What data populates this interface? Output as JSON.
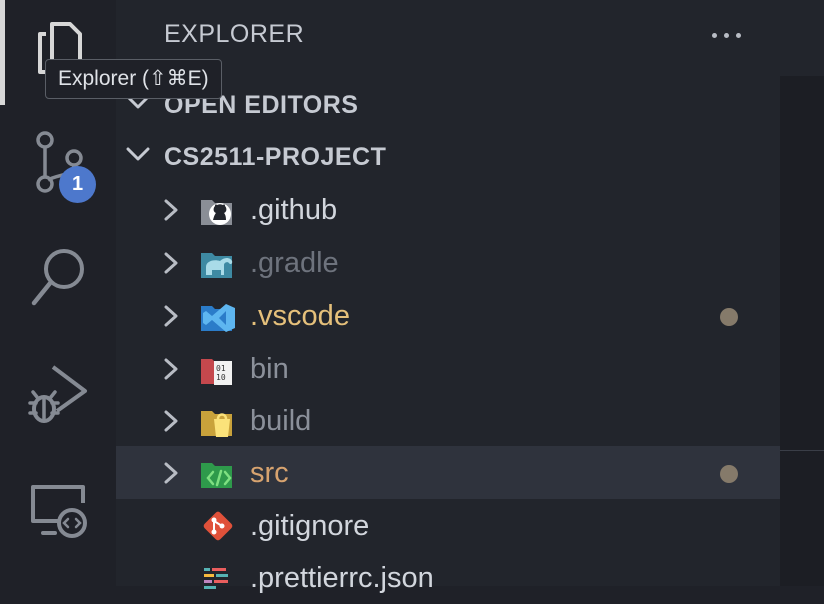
{
  "activity_bar": {
    "items": [
      "files-icon",
      "source-control-icon",
      "search-icon",
      "run-debug-icon",
      "remote-explorer-icon"
    ],
    "source_control_badge": "1"
  },
  "sidebar": {
    "title": "EXPLORER",
    "sections": {
      "open_editors": "OPEN EDITORS",
      "project": "CS2511-PROJECT"
    },
    "tree": [
      {
        "name": ".github",
        "icon": "github-folder-icon",
        "color": "#d2d6dd",
        "folder": true,
        "modified": false
      },
      {
        "name": ".gradle",
        "icon": "gradle-folder-icon",
        "color": "#6e737d",
        "folder": true,
        "modified": false
      },
      {
        "name": ".vscode",
        "icon": "vscode-folder-icon",
        "color": "#e5c07b",
        "folder": true,
        "modified": true
      },
      {
        "name": "bin",
        "icon": "binary-folder-icon",
        "color": "#8b909a",
        "folder": true,
        "modified": false
      },
      {
        "name": "build",
        "icon": "build-folder-icon",
        "color": "#8b909a",
        "folder": true,
        "modified": false
      },
      {
        "name": "src",
        "icon": "source-folder-icon",
        "color": "#d7a36f",
        "folder": true,
        "modified": true,
        "selected": true
      },
      {
        "name": ".gitignore",
        "icon": "git-file-icon",
        "color": "#d2d6dd",
        "folder": false,
        "modified": false
      },
      {
        "name": ".prettierrc.json",
        "icon": "prettier-file-icon",
        "color": "#d2d6dd",
        "folder": false,
        "modified": false
      }
    ]
  },
  "tooltip": {
    "text": "Explorer (⇧⌘E)"
  },
  "colors": {
    "activity_bg": "#1f2128",
    "sidebar_bg": "#22252c",
    "selected_row": "#2f333d",
    "badge": "#4d78cc",
    "modified_dot": "#857a6a"
  }
}
